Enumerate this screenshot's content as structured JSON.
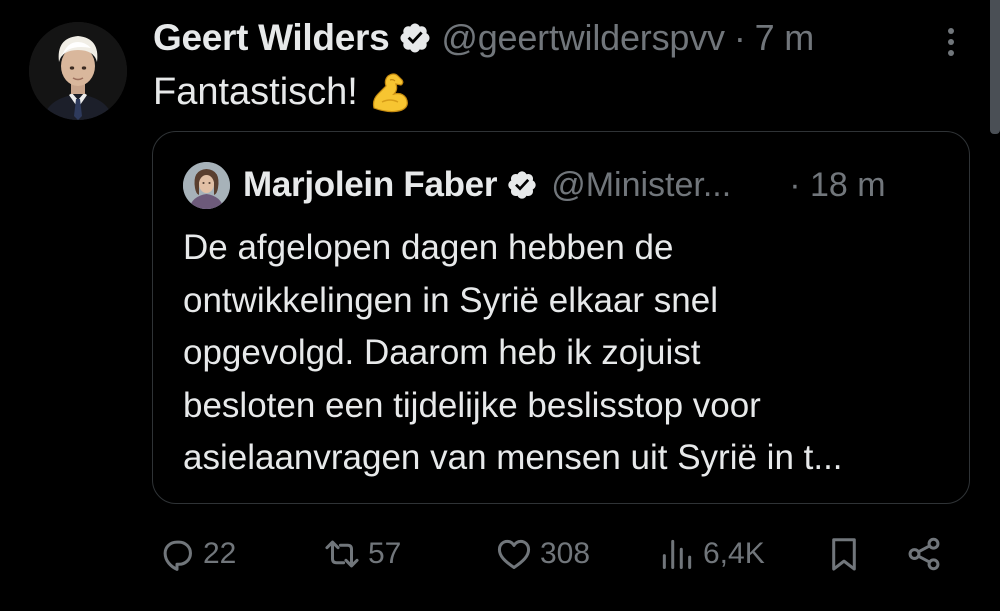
{
  "tweet": {
    "author_name": "Geert Wilders",
    "handle": "@geertwilderspvv",
    "separator": "·",
    "time": "7 m",
    "text": "Fantastisch!",
    "emoji_icon": "flexed-biceps-emoji"
  },
  "quote": {
    "author_name": "Marjolein Faber",
    "handle": "@Minister...",
    "separator": "·",
    "time": "18 m",
    "text_lines": [
      "De afgelopen dagen hebben de",
      "ontwikkelingen in Syrië elkaar snel",
      "opgevolgd. Daarom heb ik zojuist",
      "besloten een tijdelijke beslisstop voor",
      "asielaanvragen van mensen uit Syrië in t..."
    ]
  },
  "actions": {
    "replies": "22",
    "reposts": "57",
    "likes": "308",
    "views": "6,4K"
  },
  "colors": {
    "background": "#000000",
    "primary_text": "#e7e9ea",
    "secondary_text": "#71767b",
    "border": "#2f3336",
    "verified_badge": "#e7e9ea"
  },
  "icons": [
    "verified-badge-icon",
    "more-options-icon",
    "reply-icon",
    "repost-icon",
    "like-icon",
    "views-icon",
    "bookmark-icon",
    "share-icon"
  ]
}
